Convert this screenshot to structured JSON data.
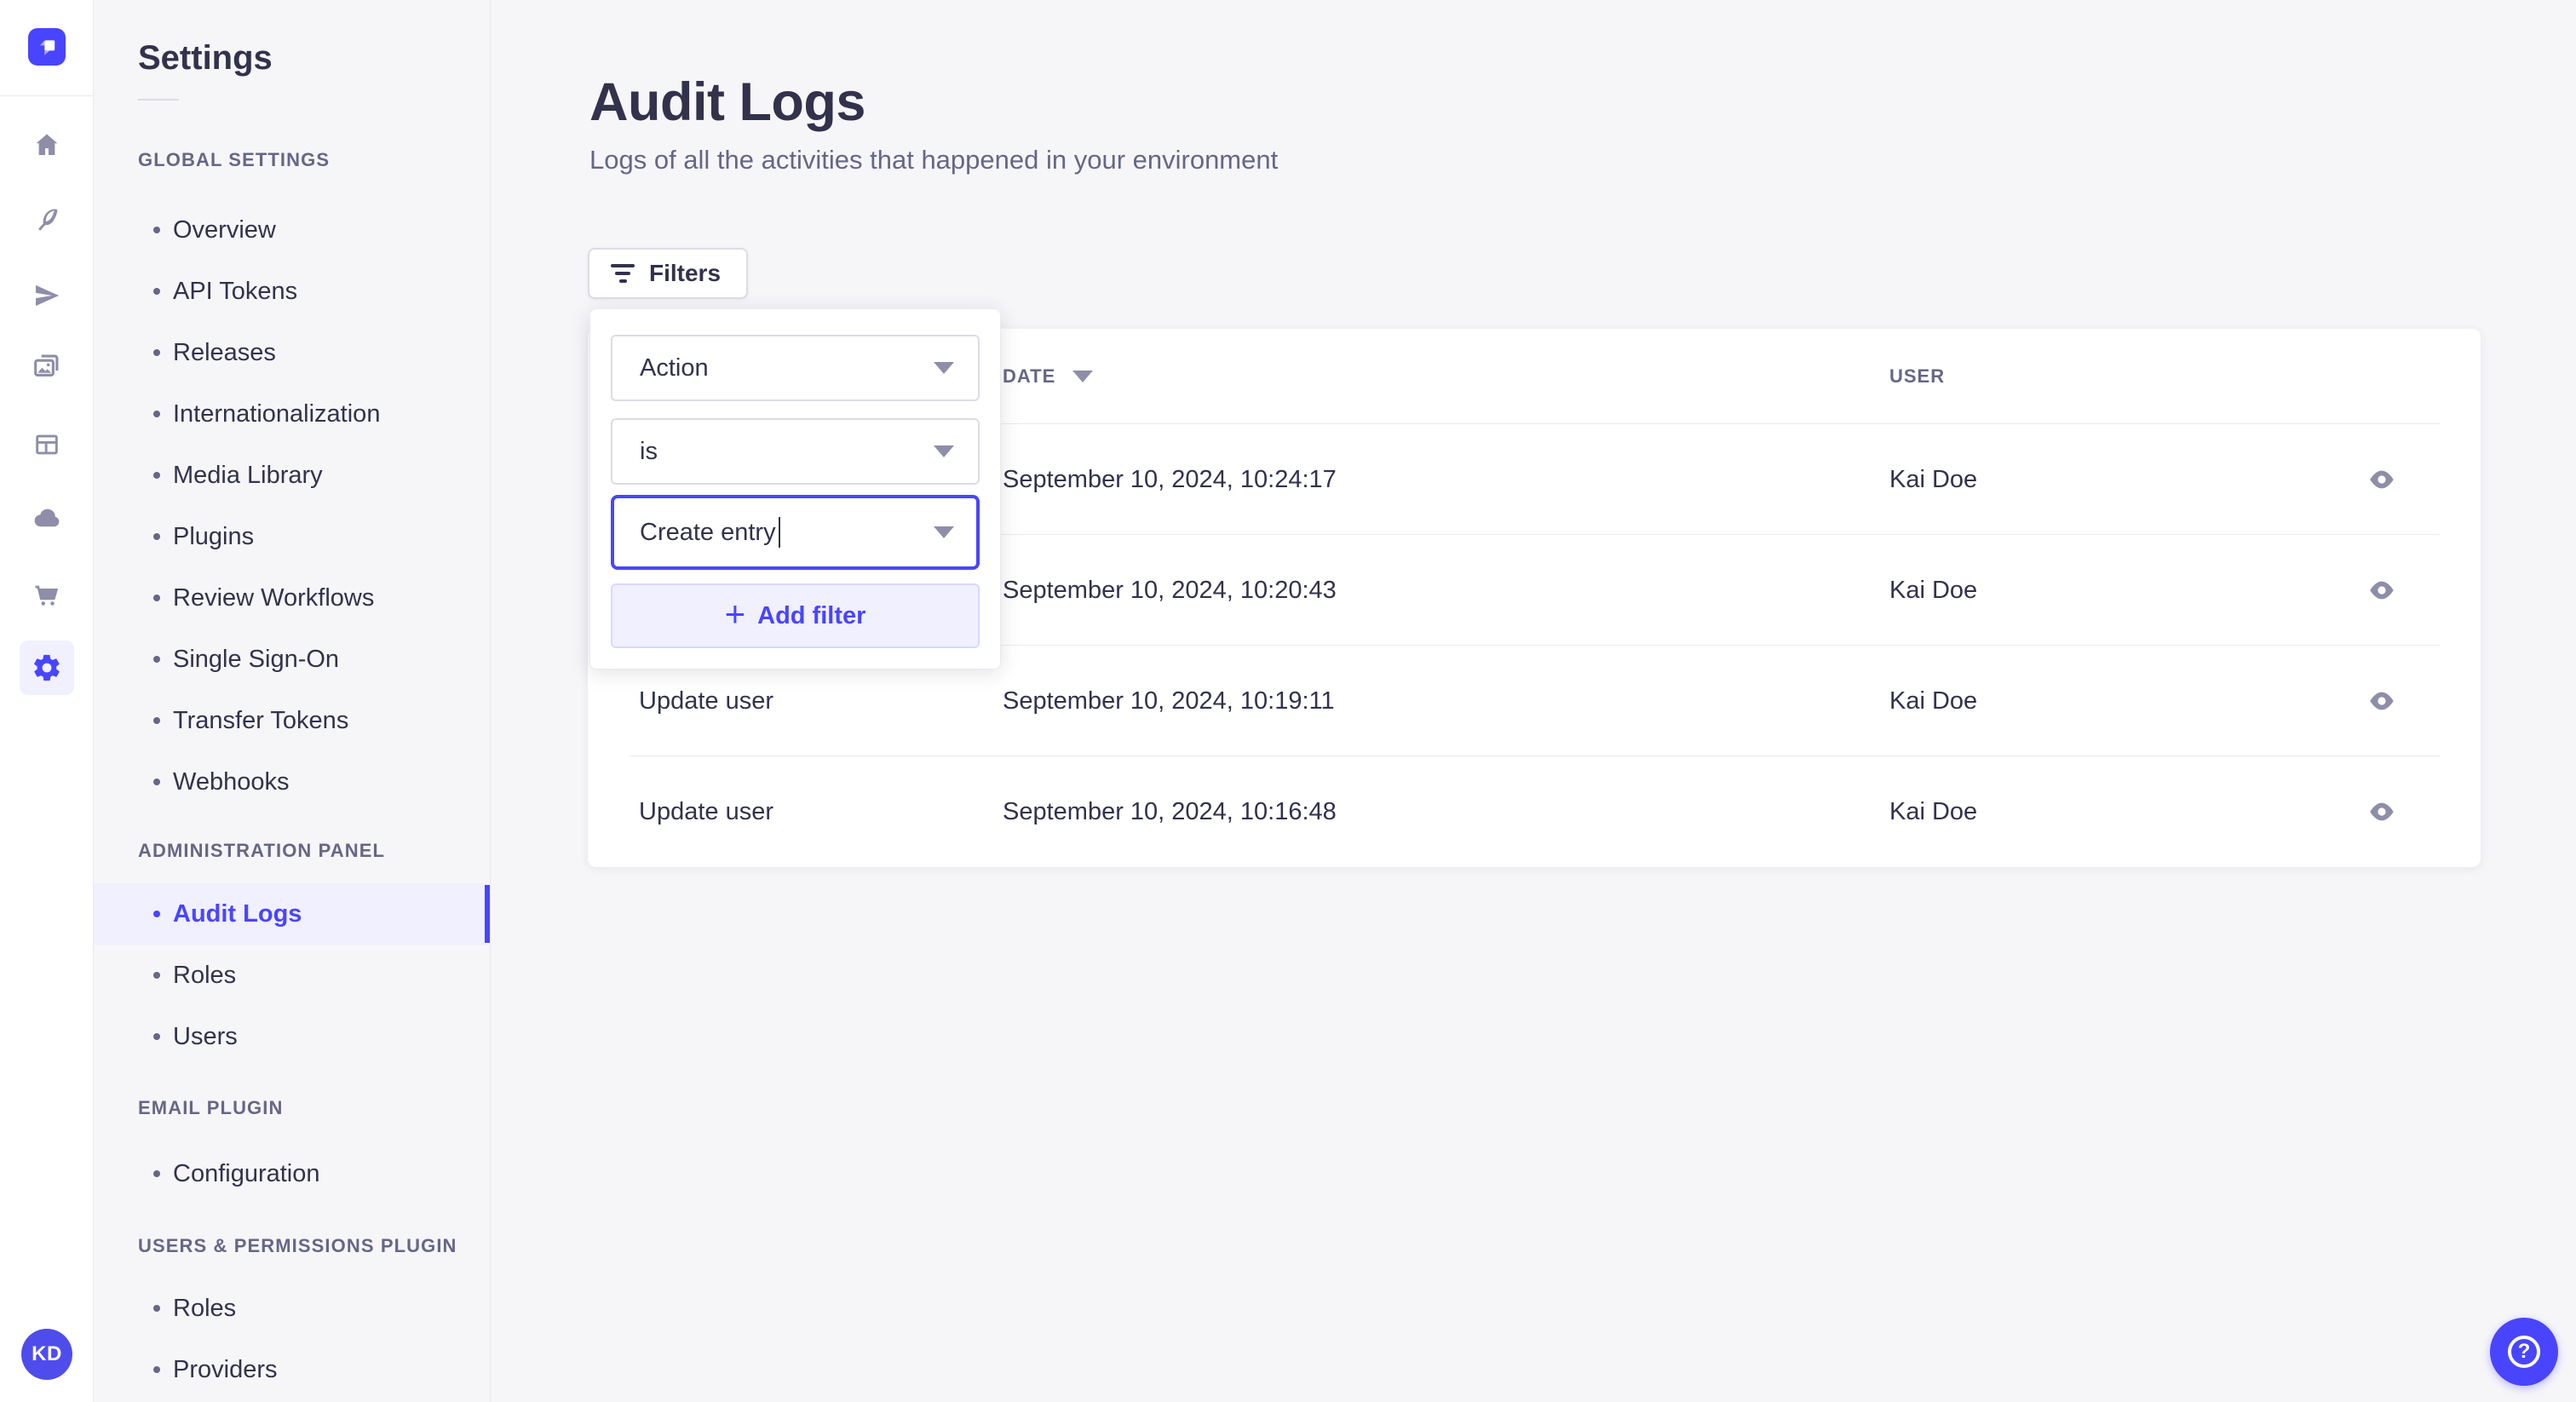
{
  "colors": {
    "accent": "#4945ff",
    "accent_bg": "#f0f0ff",
    "text": "#32324d",
    "text_muted": "#666687",
    "icon_gray": "#8e8ea9",
    "input_border": "#dcdce4",
    "divider": "#eaeaef",
    "page_bg": "#f6f6f9",
    "card_bg": "#ffffff"
  },
  "nav_rail": {
    "logo_icon": "strapi-logo",
    "icons": [
      "home-icon",
      "feather-icon",
      "paper-plane-icon",
      "media-library-icon",
      "layout-icon",
      "cloud-icon",
      "cart-icon",
      "settings-gear-icon"
    ],
    "active_icon": "settings-gear-icon",
    "avatar_initials": "KD"
  },
  "sidebar": {
    "title": "Settings",
    "sections": [
      {
        "label": "GLOBAL SETTINGS",
        "items": [
          {
            "label": "Overview"
          },
          {
            "label": "API Tokens"
          },
          {
            "label": "Releases"
          },
          {
            "label": "Internationalization"
          },
          {
            "label": "Media Library"
          },
          {
            "label": "Plugins"
          },
          {
            "label": "Review Workflows"
          },
          {
            "label": "Single Sign-On"
          },
          {
            "label": "Transfer Tokens"
          },
          {
            "label": "Webhooks"
          }
        ]
      },
      {
        "label": "ADMINISTRATION PANEL",
        "items": [
          {
            "label": "Audit Logs",
            "active": true
          },
          {
            "label": "Roles"
          },
          {
            "label": "Users"
          }
        ]
      },
      {
        "label": "EMAIL PLUGIN",
        "items": [
          {
            "label": "Configuration"
          }
        ]
      },
      {
        "label": "USERS & PERMISSIONS PLUGIN",
        "items": [
          {
            "label": "Roles"
          },
          {
            "label": "Providers"
          }
        ]
      }
    ]
  },
  "main": {
    "page_title": "Audit Logs",
    "page_subtitle": "Logs of all the activities that happened in your environment",
    "filters_button_label": "Filters",
    "filter_popover": {
      "field_value": "Action",
      "operator_value": "is",
      "action_value": "Create entry",
      "plus_glyph": "+",
      "add_filter_label": "Add filter"
    },
    "table": {
      "action_header": "",
      "date_header": "DATE",
      "user_header": "USER",
      "rows": [
        {
          "action": "",
          "date": "September 10, 2024, 10:24:17",
          "user": "Kai Doe"
        },
        {
          "action": "",
          "date": "September 10, 2024, 10:20:43",
          "user": "Kai Doe"
        },
        {
          "action": "Update user",
          "date": "September 10, 2024, 10:19:11",
          "user": "Kai Doe"
        },
        {
          "action": "Update user",
          "date": "September 10, 2024, 10:16:48",
          "user": "Kai Doe"
        }
      ]
    }
  },
  "help": {
    "glyph": "?"
  }
}
